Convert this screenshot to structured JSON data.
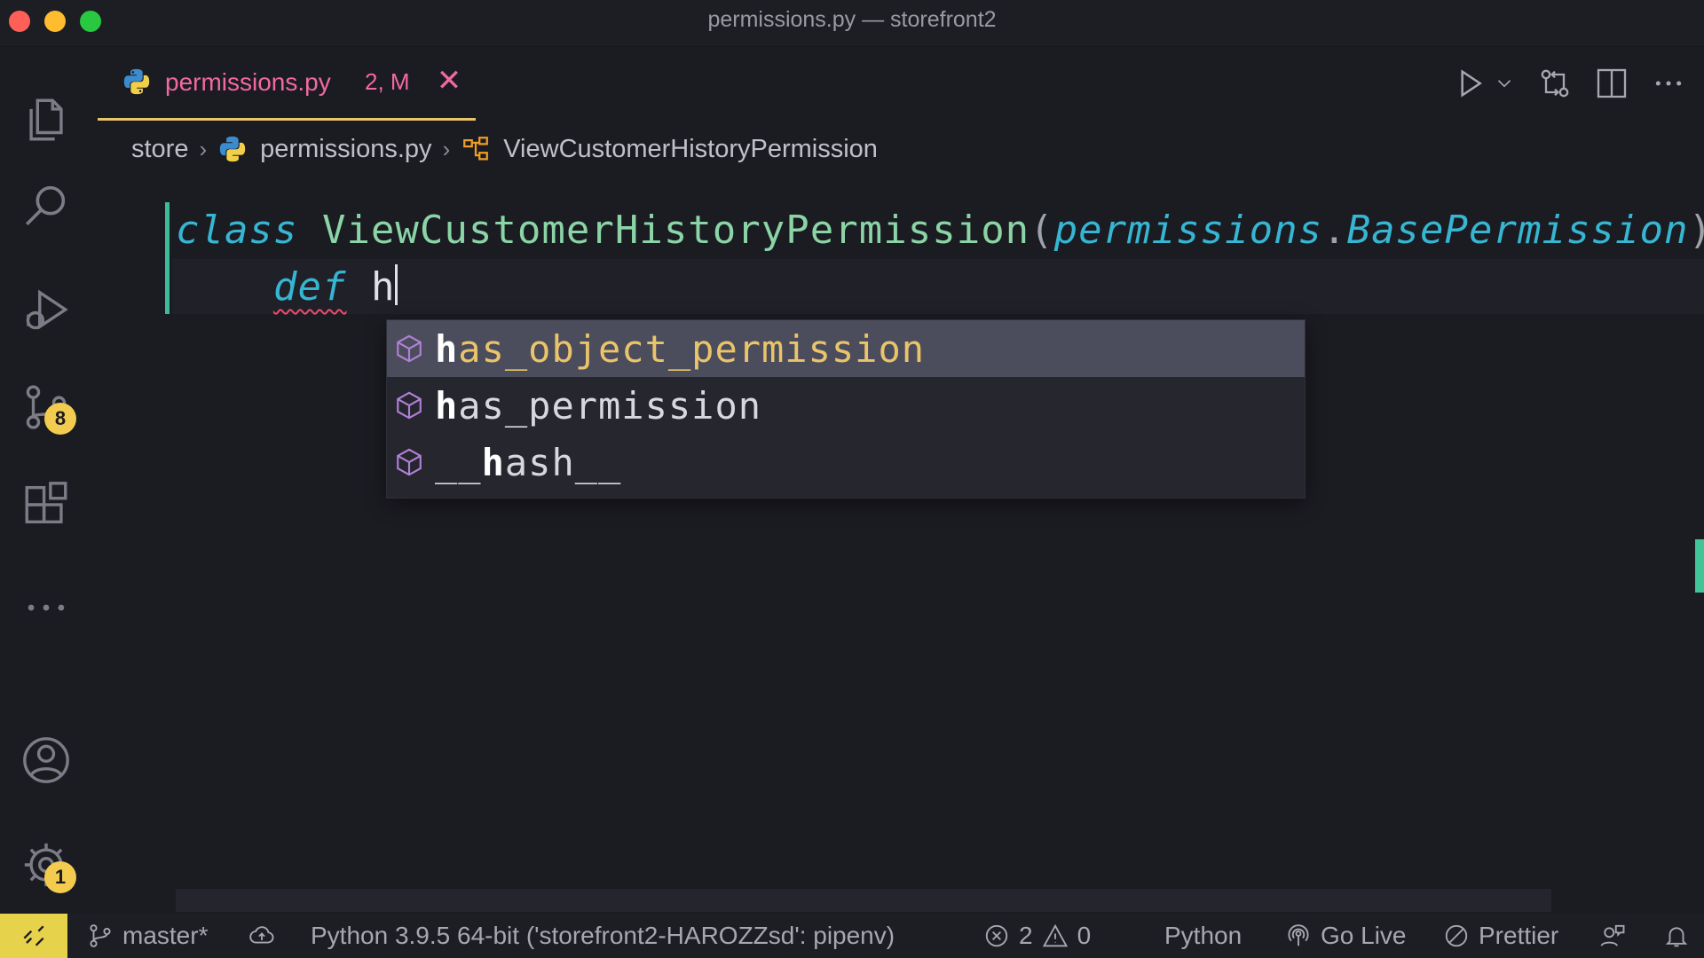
{
  "window": {
    "title": "permissions.py — storefront2"
  },
  "activity_bar": {
    "items": [
      "explorer-icon",
      "search-icon",
      "run-debug-icon",
      "source-control-icon",
      "extensions-icon",
      "more-icon"
    ],
    "source_control_badge": "8",
    "settings_badge": "1"
  },
  "tab": {
    "filename": "permissions.py",
    "status": "2, M"
  },
  "breadcrumb": {
    "folder": "store",
    "file": "permissions.py",
    "symbol": "ViewCustomerHistoryPermission"
  },
  "code": {
    "line1": {
      "keyword": "class",
      "class_name": "ViewCustomerHistoryPermission",
      "open_paren": "(",
      "module": "permissions",
      "dot": ".",
      "base": "BasePermission",
      "close": "):"
    },
    "line2": {
      "keyword": "def",
      "typed": "h"
    }
  },
  "suggestions": [
    {
      "match": "h",
      "rest": "as_object_permission",
      "selected": true
    },
    {
      "match": "h",
      "rest": "as_permission",
      "selected": false
    },
    {
      "prefix": "__",
      "match": "h",
      "rest": "ash__",
      "selected": false
    }
  ],
  "status_bar": {
    "branch": "master*",
    "interpreter": "Python 3.9.5 64-bit ('storefront2-HAROZZsd': pipenv)",
    "errors": "2",
    "warnings": "0",
    "language": "Python",
    "go_live": "Go Live",
    "prettier": "Prettier"
  },
  "colors": {
    "accent_yellow": "#e9c46a",
    "tab_pink": "#f06aa0",
    "keyword": "#36b6d2",
    "class": "#8ad4a6",
    "remote_bg": "#e7d24b"
  }
}
